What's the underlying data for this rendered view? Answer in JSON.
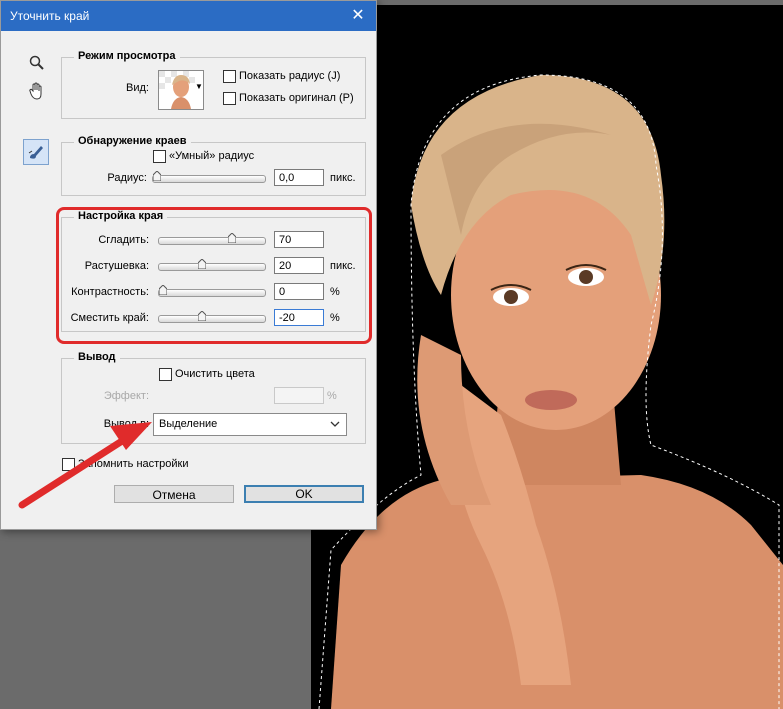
{
  "dialog": {
    "title": "Уточнить край",
    "close_glyph": "✕"
  },
  "tools": [
    {
      "icon": "zoom-icon",
      "glyph": "🔍"
    },
    {
      "icon": "hand-icon",
      "glyph": "✋"
    },
    {
      "icon": "refine-radius-brush-icon",
      "glyph": "🖌"
    }
  ],
  "view_mode": {
    "legend": "Режим просмотра",
    "view_label": "Вид:",
    "show_radius": {
      "label": "Показать радиус (J)",
      "checked": false
    },
    "show_original": {
      "label": "Показать оригинал (P)",
      "checked": false
    }
  },
  "edge_detection": {
    "legend": "Обнаружение краев",
    "smart_radius": {
      "label": "«Умный» радиус",
      "checked": false
    },
    "radius_label": "Радиус:",
    "radius_value": "0,0",
    "radius_unit": "пикс.",
    "radius_level": 0
  },
  "adjust_edge": {
    "legend": "Настройка края",
    "smooth": {
      "label": "Сгладить:",
      "value": "70",
      "unit": "",
      "level": 0.7
    },
    "feather": {
      "label": "Растушевка:",
      "value": "20",
      "unit": "пикс.",
      "level": 0.4
    },
    "contrast": {
      "label": "Контрастность:",
      "value": "0",
      "unit": "%",
      "level": 0.0
    },
    "shift_edge": {
      "label": "Сместить край:",
      "value": "-20",
      "unit": "%",
      "level": 0.4
    }
  },
  "output": {
    "legend": "Вывод",
    "decontaminate": {
      "label": "Очистить цвета",
      "checked": false
    },
    "amount_label": "Эффект:",
    "amount_unit": "%",
    "output_to_label": "Вывод в:",
    "output_to_value": "Выделение"
  },
  "remember": {
    "label": "Запомнить настройки",
    "checked": false
  },
  "buttons": {
    "cancel": "Отмена",
    "ok": "OK"
  },
  "colors": {
    "titlebar": "#2b6cc4",
    "highlight": "#e02b2b"
  }
}
